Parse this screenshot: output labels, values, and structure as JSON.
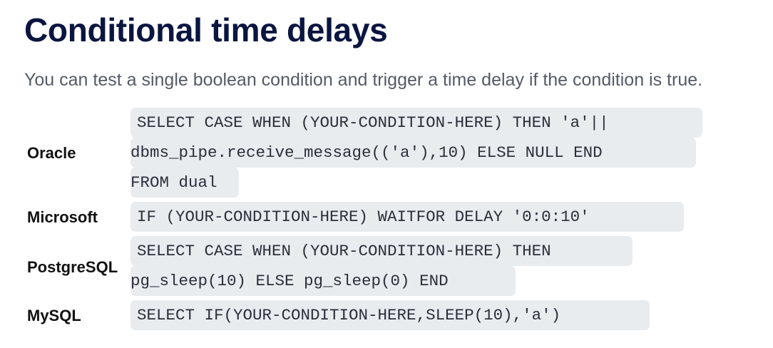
{
  "title": "Conditional time delays",
  "intro": "You can test a single boolean condition and trigger a time delay if the condition is true.",
  "rows": [
    {
      "db": "Oracle",
      "code_lines": [
        "SELECT CASE WHEN (YOUR-CONDITION-HERE) THEN 'a'||",
        "dbms_pipe.receive_message(('a'),10) ELSE NULL END",
        "FROM dual"
      ]
    },
    {
      "db": "Microsoft",
      "code_lines": [
        "IF (YOUR-CONDITION-HERE) WAITFOR DELAY '0:0:10'"
      ]
    },
    {
      "db": "PostgreSQL",
      "code_lines": [
        "SELECT CASE WHEN (YOUR-CONDITION-HERE) THEN",
        "pg_sleep(10) ELSE pg_sleep(0) END"
      ]
    },
    {
      "db": "MySQL",
      "code_lines": [
        "SELECT IF(YOUR-CONDITION-HERE,SLEEP(10),'a')"
      ]
    }
  ]
}
